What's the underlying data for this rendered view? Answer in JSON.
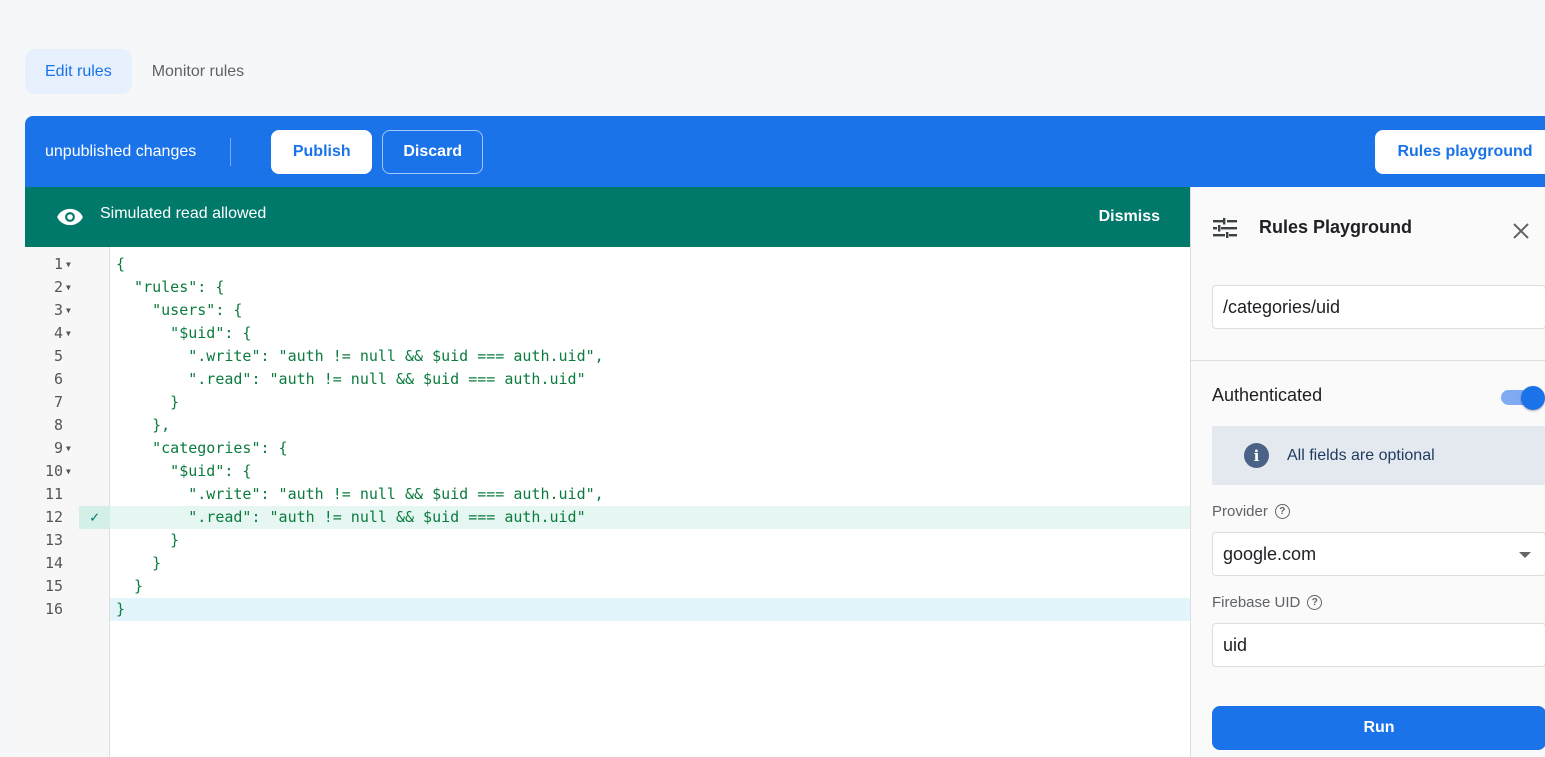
{
  "tabs": [
    {
      "label": "Edit rules",
      "active": true
    },
    {
      "label": "Monitor rules",
      "active": false
    }
  ],
  "toolbar": {
    "status": "unpublished changes",
    "publish_label": "Publish",
    "discard_label": "Discard",
    "playground_label": "Rules playground"
  },
  "banner": {
    "icon": "eye-icon",
    "message": "Simulated read allowed",
    "dismiss_label": "Dismiss"
  },
  "editor": {
    "lines": [
      {
        "n": "1",
        "fold": true,
        "text": "{"
      },
      {
        "n": "2",
        "fold": true,
        "text": "  \"rules\": {"
      },
      {
        "n": "3",
        "fold": true,
        "text": "    \"users\": {"
      },
      {
        "n": "4",
        "fold": true,
        "text": "      \"$uid\": {"
      },
      {
        "n": "5",
        "fold": false,
        "text": "        \".write\": \"auth != null && $uid === auth.uid\","
      },
      {
        "n": "6",
        "fold": false,
        "text": "        \".read\": \"auth != null && $uid === auth.uid\""
      },
      {
        "n": "7",
        "fold": false,
        "text": "      }"
      },
      {
        "n": "8",
        "fold": false,
        "text": "    },"
      },
      {
        "n": "9",
        "fold": true,
        "text": "    \"categories\": {"
      },
      {
        "n": "10",
        "fold": true,
        "text": "      \"$uid\": {"
      },
      {
        "n": "11",
        "fold": false,
        "text": "        \".write\": \"auth != null && $uid === auth.uid\","
      },
      {
        "n": "12",
        "fold": false,
        "text": "        \".read\": \"auth != null && $uid === auth.uid\"",
        "status": "allowed"
      },
      {
        "n": "13",
        "fold": false,
        "text": "      }"
      },
      {
        "n": "14",
        "fold": false,
        "text": "    }"
      },
      {
        "n": "15",
        "fold": false,
        "text": "  }"
      },
      {
        "n": "16",
        "fold": false,
        "text": "}",
        "current": true
      }
    ]
  },
  "playground": {
    "title": "Rules Playground",
    "location_value": "/categories/uid",
    "authenticated_label": "Authenticated",
    "authenticated": true,
    "info_text": "All fields are optional",
    "provider_label": "Provider",
    "provider_value": "google.com",
    "uid_label": "Firebase UID",
    "uid_value": "uid",
    "run_label": "Run"
  },
  "colors": {
    "primary": "#1a73e8",
    "banner": "#00796b",
    "code": "#0b7b3e"
  }
}
